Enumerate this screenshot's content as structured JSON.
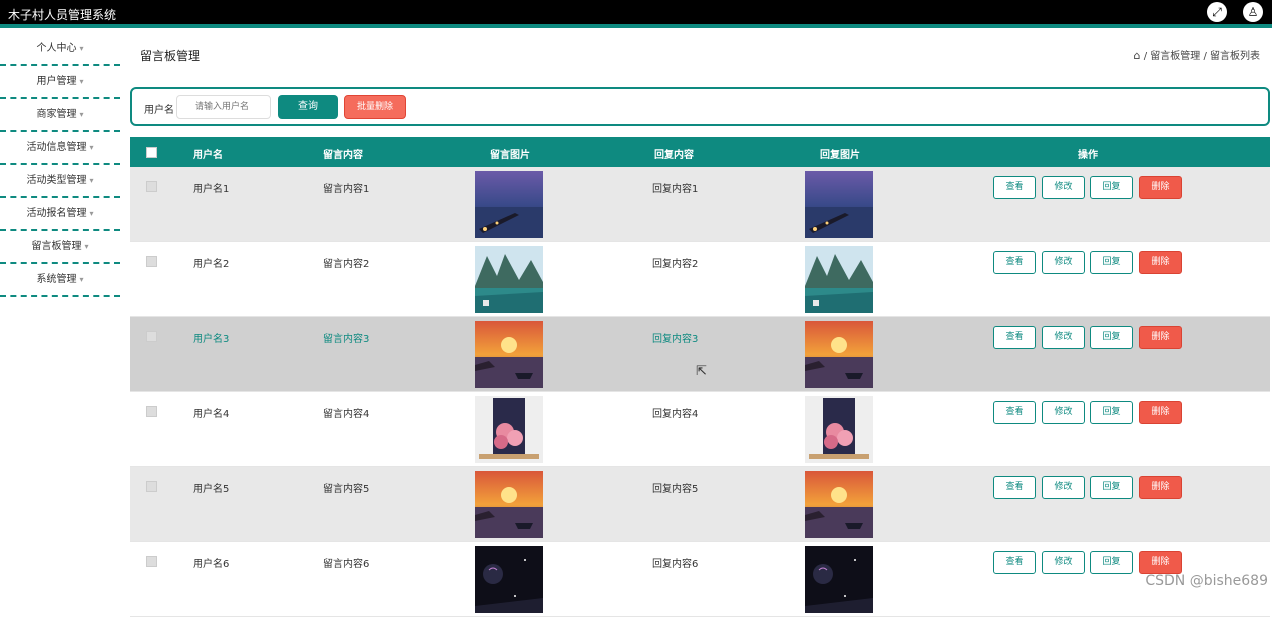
{
  "app": {
    "title": "木子村人员管理系统"
  },
  "topbar": {
    "fullscreen_icon": "⤢",
    "user_icon": "♙"
  },
  "sidebar": {
    "items": [
      {
        "label": "个人中心"
      },
      {
        "label": "用户管理"
      },
      {
        "label": "商家管理"
      },
      {
        "label": "活动信息管理"
      },
      {
        "label": "活动类型管理"
      },
      {
        "label": "活动报名管理"
      },
      {
        "label": "留言板管理"
      },
      {
        "label": "系统管理"
      }
    ]
  },
  "page": {
    "title": "留言板管理"
  },
  "breadcrumb": {
    "home_icon": "⌂",
    "level1": "留言板管理",
    "level2": "留言板列表",
    "sep": "/"
  },
  "search": {
    "label": "用户名",
    "placeholder": "请输入用户名",
    "query_label": "查询",
    "batch_delete_label": "批量删除"
  },
  "table": {
    "headers": {
      "username": "用户名",
      "content": "留言内容",
      "image": "留言图片",
      "reply": "回复内容",
      "reply_image": "回复图片",
      "actions": "操作"
    },
    "actions": {
      "view": "查看",
      "edit": "修改",
      "reply": "回复",
      "delete": "删除"
    },
    "rows": [
      {
        "username": "用户名1",
        "content": "留言内容1",
        "reply": "回复内容1",
        "image": "night-pier"
      },
      {
        "username": "用户名2",
        "content": "留言内容2",
        "reply": "回复内容2",
        "image": "mountain-lake"
      },
      {
        "username": "用户名3",
        "content": "留言内容3",
        "reply": "回复内容3",
        "image": "sunset-boat"
      },
      {
        "username": "用户名4",
        "content": "留言内容4",
        "reply": "回复内容4",
        "image": "pink-flowers"
      },
      {
        "username": "用户名5",
        "content": "留言内容5",
        "reply": "回复内容5",
        "image": "sunset-boat"
      },
      {
        "username": "用户名6",
        "content": "留言内容6",
        "reply": "回复内容6",
        "image": "dark-night"
      }
    ]
  },
  "watermark": "CSDN @bishe689"
}
